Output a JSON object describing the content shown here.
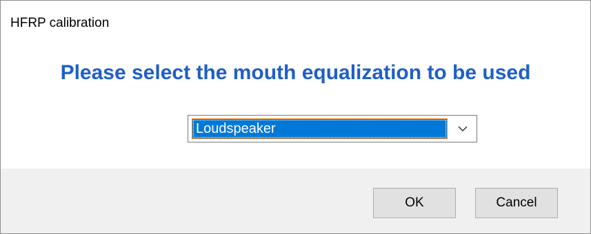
{
  "window": {
    "title": "HFRP calibration"
  },
  "prompt": {
    "text": "Please select the mouth equalization to be used"
  },
  "equalization_select": {
    "selected_value": "Loudspeaker",
    "icon": "chevron-down-icon"
  },
  "buttons": {
    "ok_label": "OK",
    "cancel_label": "Cancel"
  },
  "colors": {
    "prompt_text": "#1e5fc8",
    "selection_background": "#0078d7",
    "selection_border": "#ff8a1c",
    "footer_background": "#f0f0f0",
    "button_background": "#e1e1e1"
  }
}
